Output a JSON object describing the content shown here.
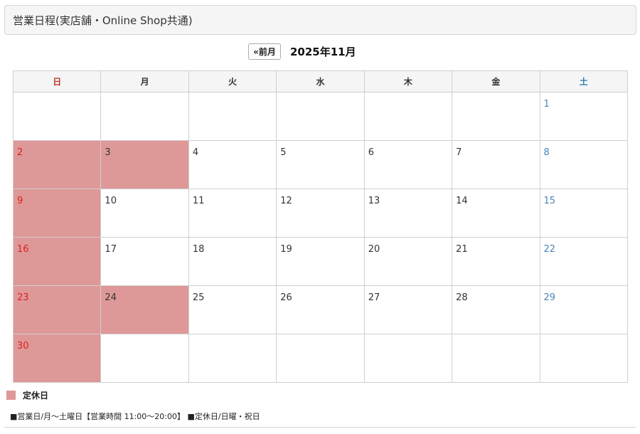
{
  "header": {
    "title": "営業日程(実店舗・Online Shop共通)"
  },
  "nav": {
    "prev_label": "«前月",
    "month_label": "2025年11月"
  },
  "weekdays": [
    "日",
    "月",
    "火",
    "水",
    "木",
    "金",
    "土"
  ],
  "weeks": [
    [
      "",
      "",
      "",
      "",
      "",
      "",
      "1"
    ],
    [
      "2",
      "3",
      "4",
      "5",
      "6",
      "7",
      "8"
    ],
    [
      "9",
      "10",
      "11",
      "12",
      "13",
      "14",
      "15"
    ],
    [
      "16",
      "17",
      "18",
      "19",
      "20",
      "21",
      "22"
    ],
    [
      "23",
      "24",
      "25",
      "26",
      "27",
      "28",
      "29"
    ],
    [
      "30",
      "",
      "",
      "",
      "",
      "",
      ""
    ]
  ],
  "closed_days": [
    "2",
    "3",
    "9",
    "16",
    "23",
    "24",
    "30"
  ],
  "legend": {
    "label": "定休日",
    "color": "#de9898"
  },
  "note": "■営業日/月～土曜日【営業時間 11:00～20:00】 ■定休日/日曜・祝日",
  "colors": {
    "sunday": "#e02020",
    "saturday": "#4a86b8",
    "closed": "#de9898"
  }
}
